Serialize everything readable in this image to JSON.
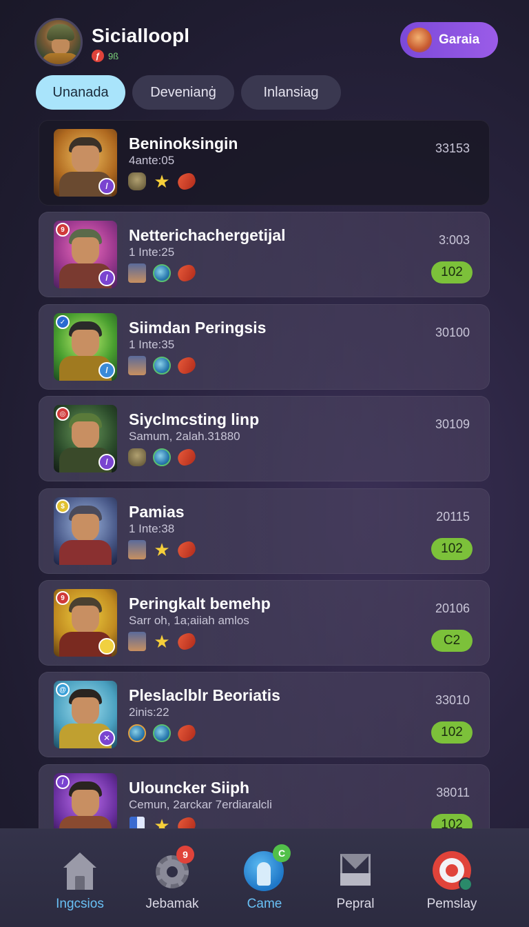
{
  "header": {
    "title": "Sicialloopl",
    "status_text": "9ß",
    "status_dot": "ƒ",
    "action_label": "Garaia"
  },
  "tabs": [
    {
      "label": "Unanada",
      "active": true
    },
    {
      "label": "Devenianġ",
      "active": false
    },
    {
      "label": "Inlansiag",
      "active": false
    }
  ],
  "colors": {
    "accent": "#9b5ce8",
    "tab_active": "#a9e4fb",
    "pill_green": "#7cc13a",
    "nav_active": "#69c0f5"
  },
  "players": [
    {
      "name": "Beninoksingin",
      "sub": "4ante:05",
      "score": "33153",
      "pill": "",
      "icons": [
        "helmet-icon",
        "star-icon",
        "meat-icon"
      ]
    },
    {
      "name": "Netterichachergetijal",
      "sub": "1 Inte:25",
      "score": "3:003",
      "pill": "102",
      "icons": [
        "portrait-icon",
        "orb-icon",
        "meat-icon"
      ]
    },
    {
      "name": "Siimdan Peringsis",
      "sub": "1 Inte:35",
      "score": "30100",
      "pill": "",
      "icons": [
        "portrait-icon",
        "orb-icon",
        "meat-icon"
      ]
    },
    {
      "name": "Siyclmcsting linp",
      "sub": "Samum, 2alah.31880",
      "score": "30109",
      "pill": "",
      "icons": [
        "helmet-icon",
        "orb-icon",
        "meat-icon"
      ]
    },
    {
      "name": "Pamias",
      "sub": "1 Inte:38",
      "score": "20115",
      "pill": "102",
      "icons": [
        "portrait-icon",
        "star-icon",
        "meat-icon"
      ]
    },
    {
      "name": "Peringkalt bemehp",
      "sub": "Sarr oh, 1a;aiiah amlos",
      "score": "20106",
      "pill": "C2",
      "icons": [
        "portrait-icon",
        "star-icon",
        "meat-icon"
      ]
    },
    {
      "name": "Pleslaclblr Beoriatis",
      "sub": "2inis:22",
      "score": "33010",
      "pill": "102",
      "icons": [
        "orb-icon",
        "orb-icon",
        "meat-icon"
      ]
    },
    {
      "name": "Ulouncker Siiph",
      "sub": "Cemun, 2arckar 7erdiaralcli",
      "score": "38011",
      "pill": "102",
      "icons": [
        "bar-icon",
        "star-icon",
        "meat-icon"
      ]
    }
  ],
  "nav": [
    {
      "label": "Ingcsios",
      "icon": "home-icon",
      "active": true
    },
    {
      "label": "Jebamak",
      "icon": "gear-icon",
      "badge": "9",
      "active": false
    },
    {
      "label": "Came",
      "icon": "game-icon",
      "badge": "C",
      "active": true
    },
    {
      "label": "Pepral",
      "icon": "mail-icon",
      "active": false
    },
    {
      "label": "Pemslay",
      "icon": "target-icon",
      "active": false
    }
  ]
}
